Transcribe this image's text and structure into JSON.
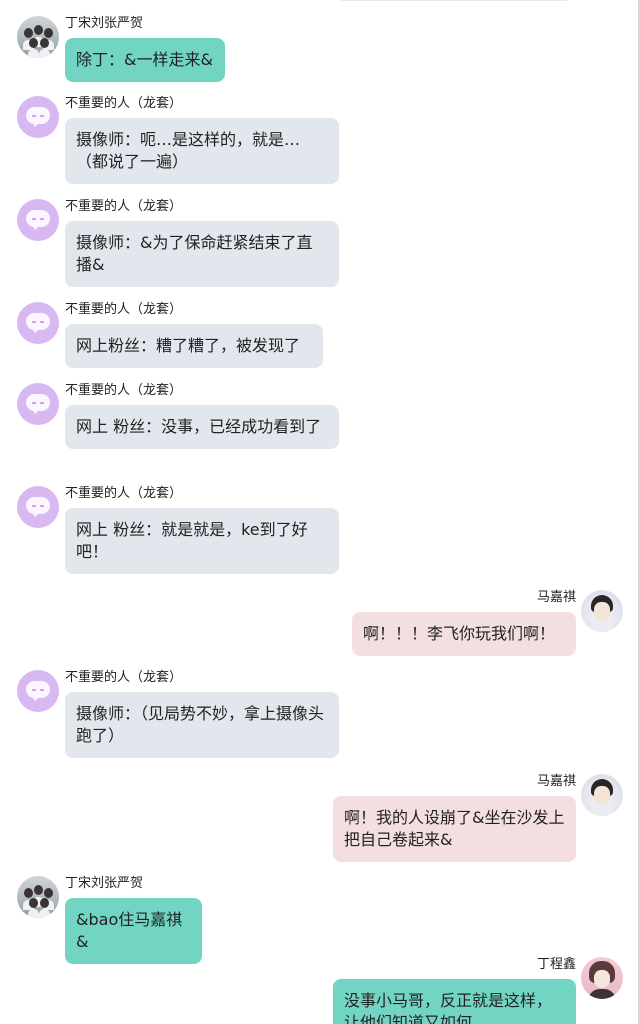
{
  "messages": [
    {
      "side": "left",
      "name": "丁宋刘张严贺",
      "text": "除丁：&一样走来&",
      "color": "#72d5c4",
      "avatar": "group-photo-avatar"
    },
    {
      "side": "left",
      "name": "不重要的人（龙套）",
      "text": "摄像师：呃…是这样的，就是…（都说了一遍）",
      "color": "#e2e6ed",
      "avatar": "chat-bubble-avatar"
    },
    {
      "side": "left",
      "name": "不重要的人（龙套）",
      "text": "摄像师：&为了保命赶紧结束了直播&",
      "color": "#e2e6ed",
      "avatar": "chat-bubble-avatar"
    },
    {
      "side": "left",
      "name": "不重要的人（龙套）",
      "text": "网上粉丝：糟了糟了，被发现了",
      "color": "#e2e6ed",
      "avatar": "chat-bubble-avatar"
    },
    {
      "side": "left",
      "name": "不重要的人（龙套）",
      "text": "网上 粉丝：没事，已经成功看到了",
      "color": "#e2e6ed",
      "avatar": "chat-bubble-avatar"
    },
    {
      "side": "left",
      "name": "不重要的人（龙套）",
      "text": "网上 粉丝：就是就是，ke到了好吧！",
      "color": "#e2e6ed",
      "avatar": "chat-bubble-avatar"
    },
    {
      "side": "right",
      "name": "马嘉祺",
      "text": "啊！！！李飞你玩我们啊！",
      "color": "#f3dfe0",
      "avatar": "portrait-avatar"
    },
    {
      "side": "left",
      "name": "不重要的人（龙套）",
      "text": "摄像师：（见局势不妙，拿上摄像头跑了）",
      "color": "#e2e6ed",
      "avatar": "chat-bubble-avatar"
    },
    {
      "side": "right",
      "name": "马嘉祺",
      "text": "啊！我的人设崩了&坐在沙发上把自己卷起来&",
      "color": "#f3dfe0",
      "avatar": "portrait-avatar"
    },
    {
      "side": "left",
      "name": "丁宋刘张严贺",
      "text": "&bao住马嘉祺&",
      "color": "#72d5c4",
      "avatar": "group-photo-avatar"
    },
    {
      "side": "right",
      "name": "丁程鑫",
      "text": "没事小马哥，反正就是这样，让他们知道又如何",
      "color": "#72d5c4",
      "avatar": "portrait-avatar"
    }
  ]
}
